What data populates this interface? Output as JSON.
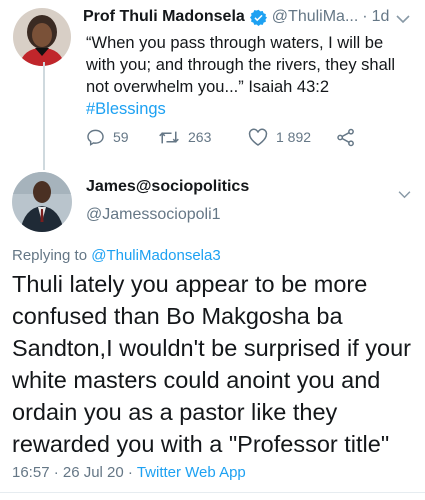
{
  "original_tweet": {
    "display_name": "Prof Thuli Madonsela",
    "handle": "@ThuliMa...",
    "separator": "·",
    "time_ago": "1d",
    "text": "“When you pass through waters, I will be with you; and through the rivers, they shall not overwhelm you...” Isaiah 43:2",
    "hashtag": "#Blessings",
    "reply_count": "59",
    "retweet_count": "263",
    "like_count": "1 892",
    "verified": true,
    "accent_color": "#1da1f2"
  },
  "reply_tweet": {
    "display_name": "James@sociopolitics",
    "handle": "@Jamessociopoli1",
    "replying_to_label": "Replying to",
    "replying_to_handle": "@ThuliMadonsela3",
    "text": "Thuli lately you appear to be more confused than Bo Makgosha ba Sandton,I wouldn't be surprised if your white masters could anoint you and ordain you as a pastor like they rewarded you with a \"Professor title\"",
    "timestamp": "16:57 · 26 Jul 20 ·",
    "source": "Twitter Web App"
  }
}
